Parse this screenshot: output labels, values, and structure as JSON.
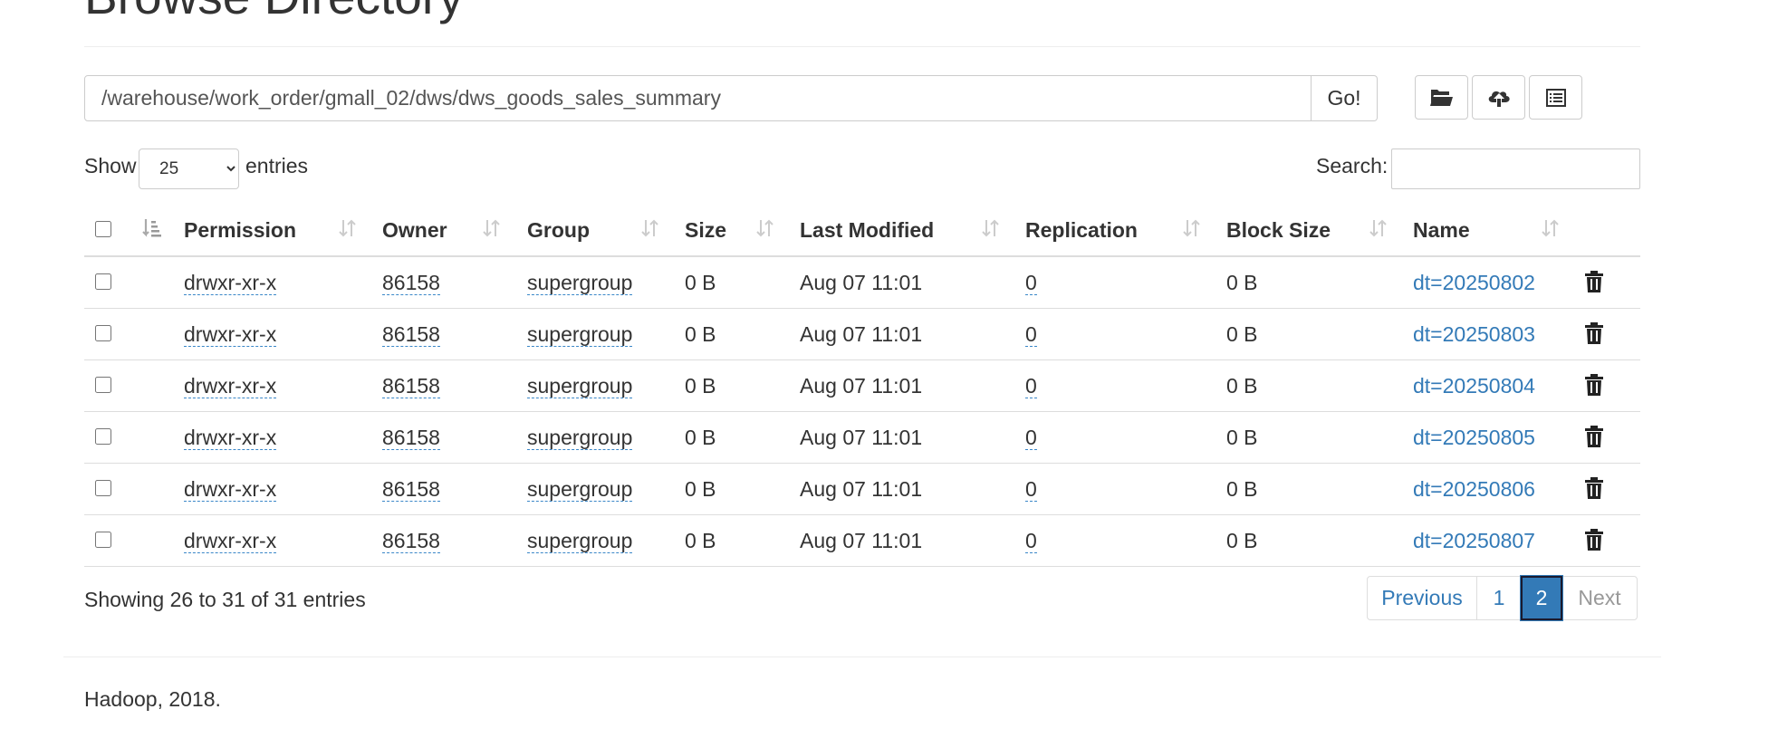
{
  "page": {
    "title": "Browse Directory"
  },
  "path_bar": {
    "value": "/warehouse/work_order/gmall_02/dws/dws_goods_sales_summary",
    "go_label": "Go!"
  },
  "toolbar": {
    "icons": [
      "folder-open-icon",
      "cloud-upload-icon",
      "list-alt-icon"
    ]
  },
  "length": {
    "show_label": "Show",
    "selected": "25",
    "entries_label": "entries"
  },
  "search": {
    "label": "Search:",
    "value": ""
  },
  "table": {
    "headers": {
      "permission": "Permission",
      "owner": "Owner",
      "group": "Group",
      "size": "Size",
      "last_modified": "Last Modified",
      "replication": "Replication",
      "block_size": "Block Size",
      "name": "Name"
    },
    "rows": [
      {
        "permission": "drwxr-xr-x",
        "owner": "86158",
        "group": "supergroup",
        "size": "0 B",
        "last_modified": "Aug 07 11:01",
        "replication": "0",
        "block_size": "0 B",
        "name": "dt=20250802"
      },
      {
        "permission": "drwxr-xr-x",
        "owner": "86158",
        "group": "supergroup",
        "size": "0 B",
        "last_modified": "Aug 07 11:01",
        "replication": "0",
        "block_size": "0 B",
        "name": "dt=20250803"
      },
      {
        "permission": "drwxr-xr-x",
        "owner": "86158",
        "group": "supergroup",
        "size": "0 B",
        "last_modified": "Aug 07 11:01",
        "replication": "0",
        "block_size": "0 B",
        "name": "dt=20250804"
      },
      {
        "permission": "drwxr-xr-x",
        "owner": "86158",
        "group": "supergroup",
        "size": "0 B",
        "last_modified": "Aug 07 11:01",
        "replication": "0",
        "block_size": "0 B",
        "name": "dt=20250805"
      },
      {
        "permission": "drwxr-xr-x",
        "owner": "86158",
        "group": "supergroup",
        "size": "0 B",
        "last_modified": "Aug 07 11:01",
        "replication": "0",
        "block_size": "0 B",
        "name": "dt=20250806"
      },
      {
        "permission": "drwxr-xr-x",
        "owner": "86158",
        "group": "supergroup",
        "size": "0 B",
        "last_modified": "Aug 07 11:01",
        "replication": "0",
        "block_size": "0 B",
        "name": "dt=20250807"
      }
    ]
  },
  "info": {
    "text": "Showing 26 to 31 of 31 entries"
  },
  "pagination": {
    "previous": "Previous",
    "page1": "1",
    "page2": "2",
    "next": "Next",
    "current": "2"
  },
  "colors": {
    "link": "#337ab7",
    "active_page": "#337ab7",
    "border": "#dddddd"
  },
  "footer": {
    "text": "Hadoop, 2018."
  }
}
